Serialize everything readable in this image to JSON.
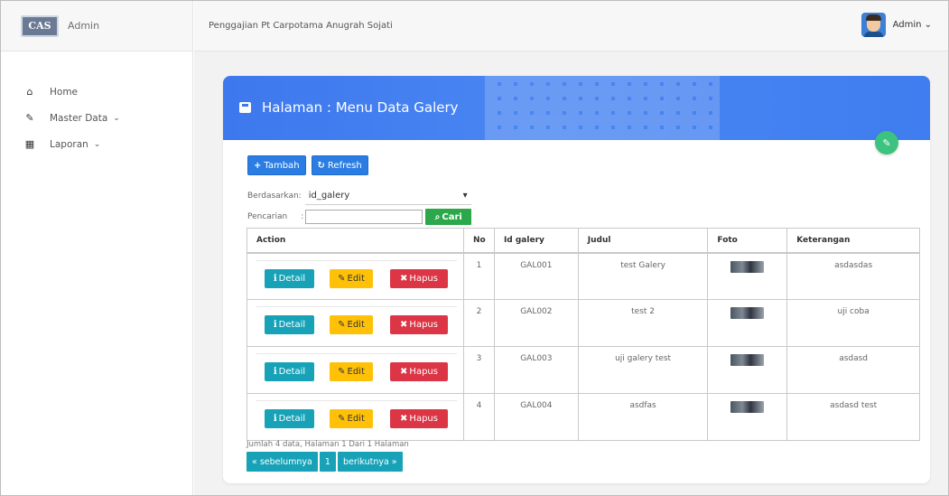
{
  "sidebar": {
    "logo_text": "CAS",
    "brand": "Admin",
    "items": [
      {
        "label": "Home",
        "icon": "home-icon",
        "caret": ""
      },
      {
        "label": "Master Data",
        "icon": "edit-icon",
        "caret": "⌄"
      },
      {
        "label": "Laporan",
        "icon": "calendar-icon",
        "caret": "⌄"
      }
    ]
  },
  "topbar": {
    "title": "Penggajian Pt Carpotama Anugrah Sojati",
    "user": "Admin ⌄"
  },
  "card": {
    "title": "Halaman : Menu Data Galery",
    "add_button": "Tambah",
    "refresh_button": "Refresh",
    "filter_label": "Berdasarkan:",
    "filter_value": "id_galery",
    "search_label": "Pencarian",
    "search_sep": ":",
    "search_value": "",
    "search_button": "Cari"
  },
  "table": {
    "headers": [
      "Action",
      "No",
      "Id galery",
      "Judul",
      "Foto",
      "Keterangan"
    ],
    "action_labels": {
      "detail": "Detail",
      "edit": "Edit",
      "hapus": "Hapus"
    },
    "rows": [
      {
        "no": "1",
        "id": "GAL001",
        "judul": "test Galery",
        "keterangan": "asdasdas"
      },
      {
        "no": "2",
        "id": "GAL002",
        "judul": "test 2",
        "keterangan": "uji coba"
      },
      {
        "no": "3",
        "id": "GAL003",
        "judul": "uji galery test",
        "keterangan": "asdasd"
      },
      {
        "no": "4",
        "id": "GAL004",
        "judul": "asdfas",
        "keterangan": "asdasd test"
      }
    ]
  },
  "footer": {
    "info": "Jumlah 4 data, Halaman 1 Dari 1 Halaman",
    "prev": "« sebelumnya",
    "page": "1",
    "next": "berikutnya »"
  },
  "colors": {
    "header_blue": "#3d78ee",
    "primary": "#2b7de3",
    "info": "#17a2b8",
    "warning": "#ffc107",
    "danger": "#dc3545",
    "success": "#2ba84a",
    "fab_green": "#3cc37f"
  }
}
